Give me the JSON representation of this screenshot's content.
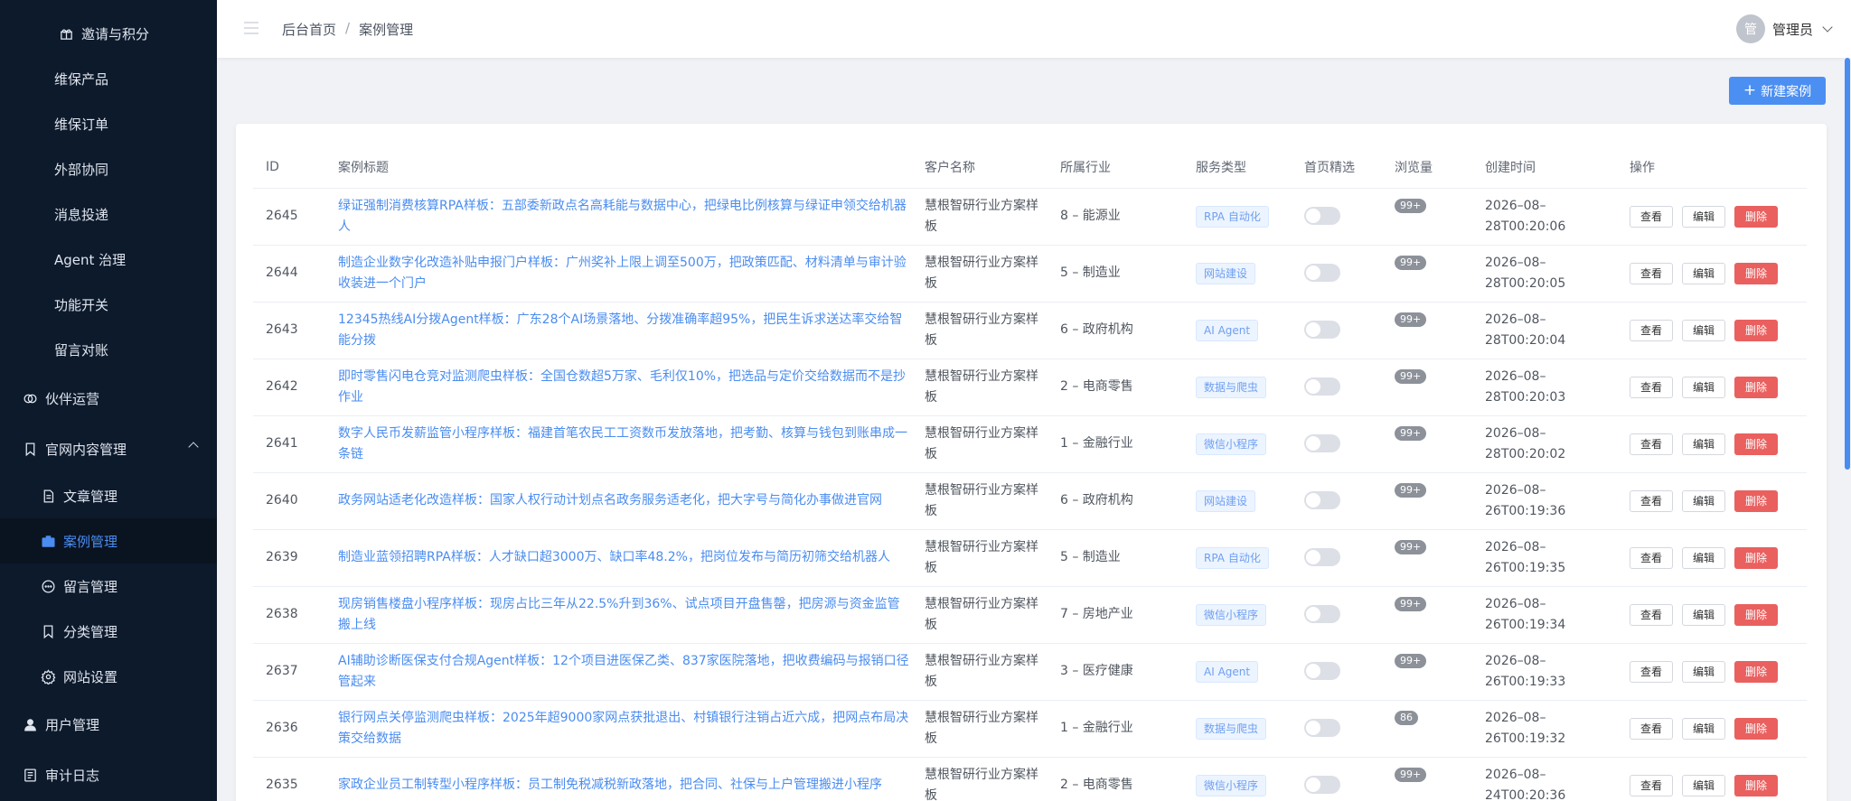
{
  "sidebar": {
    "items": [
      {
        "label": "邀请与积分",
        "icon": "gift-icon"
      },
      {
        "label": "维保产品"
      },
      {
        "label": "维保订单"
      },
      {
        "label": "外部协同"
      },
      {
        "label": "消息投递"
      },
      {
        "label": "Agent 治理"
      },
      {
        "label": "功能开关"
      },
      {
        "label": "留言对账"
      },
      {
        "label": "伙伴运营",
        "icon": "partner-icon"
      },
      {
        "label": "官网内容管理",
        "icon": "bookmark-icon"
      },
      {
        "label": "文章管理",
        "icon": "document-icon"
      },
      {
        "label": "案例管理",
        "icon": "briefcase-icon",
        "active": true
      },
      {
        "label": "留言管理",
        "icon": "chat-icon"
      },
      {
        "label": "分类管理",
        "icon": "bookmark-icon"
      },
      {
        "label": "网站设置",
        "icon": "gear-icon"
      },
      {
        "label": "用户管理",
        "icon": "user-icon"
      },
      {
        "label": "审计日志",
        "icon": "log-icon"
      }
    ]
  },
  "header": {
    "breadcrumb": [
      "后台首页",
      "案例管理"
    ],
    "breadcrumb_sep": "/",
    "user": {
      "avatar_text": "管",
      "name": "管理员"
    }
  },
  "toolbar": {
    "new_label": "新建案例",
    "new_icon": "+"
  },
  "table": {
    "columns": [
      "ID",
      "案例标题",
      "客户名称",
      "所属行业",
      "服务类型",
      "首页精选",
      "浏览量",
      "创建时间",
      "操作"
    ],
    "actions": {
      "view": "查看",
      "edit": "编辑",
      "delete": "删除"
    },
    "rows": [
      {
        "id": "2645",
        "title": "绿证强制消费核算RPA样板：五部委新政点名高耗能与数据中心，把绿电比例核算与绿证申领交给机器人",
        "client": "慧根智研行业方案样板",
        "industry": "8 – 能源业",
        "service": "RPA 自动化",
        "featured": false,
        "views": "99+",
        "created": "2026–08–28T00:20:06"
      },
      {
        "id": "2644",
        "title": "制造企业数字化改造补贴申报门户样板：广州奖补上限上调至500万，把政策匹配、材料清单与审计验收装进一个门户",
        "client": "慧根智研行业方案样板",
        "industry": "5 – 制造业",
        "service": "网站建设",
        "featured": false,
        "views": "99+",
        "created": "2026–08–28T00:20:05"
      },
      {
        "id": "2643",
        "title": "12345热线AI分拨Agent样板：广东28个AI场景落地、分拨准确率超95%，把民生诉求送达率交给智能分拨",
        "client": "慧根智研行业方案样板",
        "industry": "6 – 政府机构",
        "service": "AI Agent",
        "featured": false,
        "views": "99+",
        "created": "2026–08–28T00:20:04"
      },
      {
        "id": "2642",
        "title": "即时零售闪电仓竞对监测爬虫样板：全国仓数超5万家、毛利仅10%，把选品与定价交给数据而不是抄作业",
        "client": "慧根智研行业方案样板",
        "industry": "2 – 电商零售",
        "service": "数据与爬虫",
        "featured": false,
        "views": "99+",
        "created": "2026–08–28T00:20:03"
      },
      {
        "id": "2641",
        "title": "数字人民币发薪监管小程序样板：福建首笔农民工工资数币发放落地，把考勤、核算与钱包到账串成一条链",
        "client": "慧根智研行业方案样板",
        "industry": "1 – 金融行业",
        "service": "微信小程序",
        "featured": false,
        "views": "99+",
        "created": "2026–08–28T00:20:02"
      },
      {
        "id": "2640",
        "title": "政务网站适老化改造样板：国家人权行动计划点名政务服务适老化，把大字号与简化办事做进官网",
        "client": "慧根智研行业方案样板",
        "industry": "6 – 政府机构",
        "service": "网站建设",
        "featured": false,
        "views": "99+",
        "created": "2026–08–26T00:19:36"
      },
      {
        "id": "2639",
        "title": "制造业蓝领招聘RPA样板：人才缺口超3000万、缺口率48.2%，把岗位发布与简历初筛交给机器人",
        "client": "慧根智研行业方案样板",
        "industry": "5 – 制造业",
        "service": "RPA 自动化",
        "featured": false,
        "views": "99+",
        "created": "2026–08–26T00:19:35"
      },
      {
        "id": "2638",
        "title": "现房销售楼盘小程序样板：现房占比三年从22.5%升到36%、试点项目开盘售罄，把房源与资金监管搬上线",
        "client": "慧根智研行业方案样板",
        "industry": "7 – 房地产业",
        "service": "微信小程序",
        "featured": false,
        "views": "99+",
        "created": "2026–08–26T00:19:34"
      },
      {
        "id": "2637",
        "title": "AI辅助诊断医保支付合规Agent样板：12个项目进医保乙类、837家医院落地，把收费编码与报销口径管起来",
        "client": "慧根智研行业方案样板",
        "industry": "3 – 医疗健康",
        "service": "AI Agent",
        "featured": false,
        "views": "99+",
        "created": "2026–08–26T00:19:33"
      },
      {
        "id": "2636",
        "title": "银行网点关停监测爬虫样板：2025年超9000家网点获批退出、村镇银行注销占近六成，把网点布局决策交给数据",
        "client": "慧根智研行业方案样板",
        "industry": "1 – 金融行业",
        "service": "数据与爬虫",
        "featured": false,
        "views": "86",
        "created": "2026–08–26T00:19:32"
      },
      {
        "id": "2635",
        "title": "家政企业员工制转型小程序样板：员工制免税减税新政落地，把合同、社保与上户管理搬进小程序",
        "client": "慧根智研行业方案样板",
        "industry": "2 – 电商零售",
        "service": "微信小程序",
        "featured": false,
        "views": "99+",
        "created": "2026–08–24T00:20:36"
      }
    ]
  }
}
